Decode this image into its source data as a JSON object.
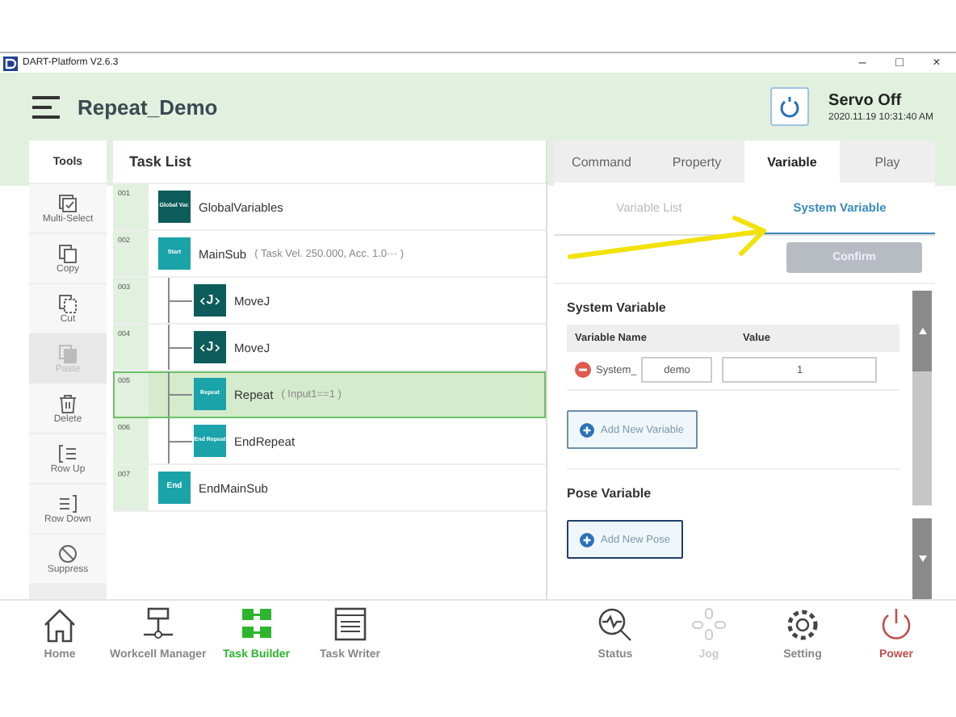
{
  "window": {
    "title": "DART-Platform V2.6.3",
    "controls": [
      "–",
      "□",
      "×"
    ]
  },
  "header": {
    "title": "Repeat_Demo",
    "servo_status": "Servo Off",
    "datetime": "2020.11.19 10:31:40 AM"
  },
  "tools": {
    "title": "Tools",
    "items": [
      {
        "kind": "multiselect",
        "label": "Multi-Select",
        "disabled": false
      },
      {
        "kind": "copy",
        "label": "Copy",
        "disabled": false
      },
      {
        "kind": "cut",
        "label": "Cut",
        "disabled": false
      },
      {
        "kind": "paste",
        "label": "Paste",
        "disabled": true
      },
      {
        "kind": "delete",
        "label": "Delete",
        "disabled": false
      },
      {
        "kind": "rowup",
        "label": "Row Up",
        "disabled": false
      },
      {
        "kind": "rowdown",
        "label": "Row Down",
        "disabled": false
      },
      {
        "kind": "suppress",
        "label": "Suppress",
        "disabled": false
      }
    ]
  },
  "task_list": {
    "title": "Task List",
    "rows": [
      {
        "number": "001",
        "kind": "global",
        "badge": "Global Var.",
        "name": "GlobalVariables",
        "selected": false
      },
      {
        "number": "002",
        "kind": "start",
        "badge": "Start",
        "name": "MainSub",
        "params": "( Task Vel. 250.000, Acc. 1.0··· )",
        "selected": false,
        "children": [
          {
            "number": "003",
            "kind": "movej",
            "badge": "J",
            "name": "MoveJ",
            "selected": false
          },
          {
            "number": "004",
            "kind": "movej",
            "badge": "J",
            "name": "MoveJ",
            "selected": false
          },
          {
            "number": "005",
            "kind": "repeat",
            "badge": "Repeat",
            "name": "Repeat",
            "params": "( Input1==1 )",
            "selected": true
          },
          {
            "number": "006",
            "kind": "endrepeat",
            "badge": "End Repeat",
            "name": "EndRepeat",
            "selected": false
          }
        ]
      },
      {
        "number": "007",
        "kind": "end",
        "badge": "End",
        "name": "EndMainSub",
        "selected": false
      }
    ]
  },
  "panel": {
    "tabs": [
      {
        "label": "Command",
        "selected": false
      },
      {
        "label": "Property",
        "selected": false
      },
      {
        "label": "Variable",
        "selected": true
      },
      {
        "label": "Play",
        "selected": false
      }
    ],
    "subtabs": [
      {
        "label": "Variable List",
        "selected": false
      },
      {
        "label": "System Variable",
        "selected": true
      }
    ],
    "confirm": {
      "label": "Confirm",
      "disabled": true
    },
    "system_variable": {
      "title": "System Variable",
      "columns": [
        "Variable Name",
        "Value"
      ],
      "rows": [
        {
          "prefix": "System_",
          "name": "demo",
          "value": "1"
        }
      ],
      "add_button": "Add New Variable"
    },
    "pose_variable": {
      "title": "Pose Variable",
      "add_button": "Add New Pose"
    }
  },
  "nav": {
    "left": [
      {
        "kind": "home",
        "label": "Home",
        "selected": false,
        "disabled": false
      },
      {
        "kind": "workcell",
        "label": "Workcell Manager",
        "selected": false,
        "disabled": false
      },
      {
        "kind": "taskbuilder",
        "label": "Task Builder",
        "selected": true,
        "disabled": false
      },
      {
        "kind": "taskwriter",
        "label": "Task Writer",
        "selected": false,
        "disabled": false
      }
    ],
    "right": [
      {
        "kind": "status",
        "label": "Status",
        "selected": false,
        "disabled": false
      },
      {
        "kind": "jog",
        "label": "Jog",
        "selected": false,
        "disabled": true
      },
      {
        "kind": "setting",
        "label": "Setting",
        "selected": false,
        "disabled": false
      },
      {
        "kind": "power",
        "label": "Power",
        "selected": false,
        "disabled": false
      }
    ]
  }
}
